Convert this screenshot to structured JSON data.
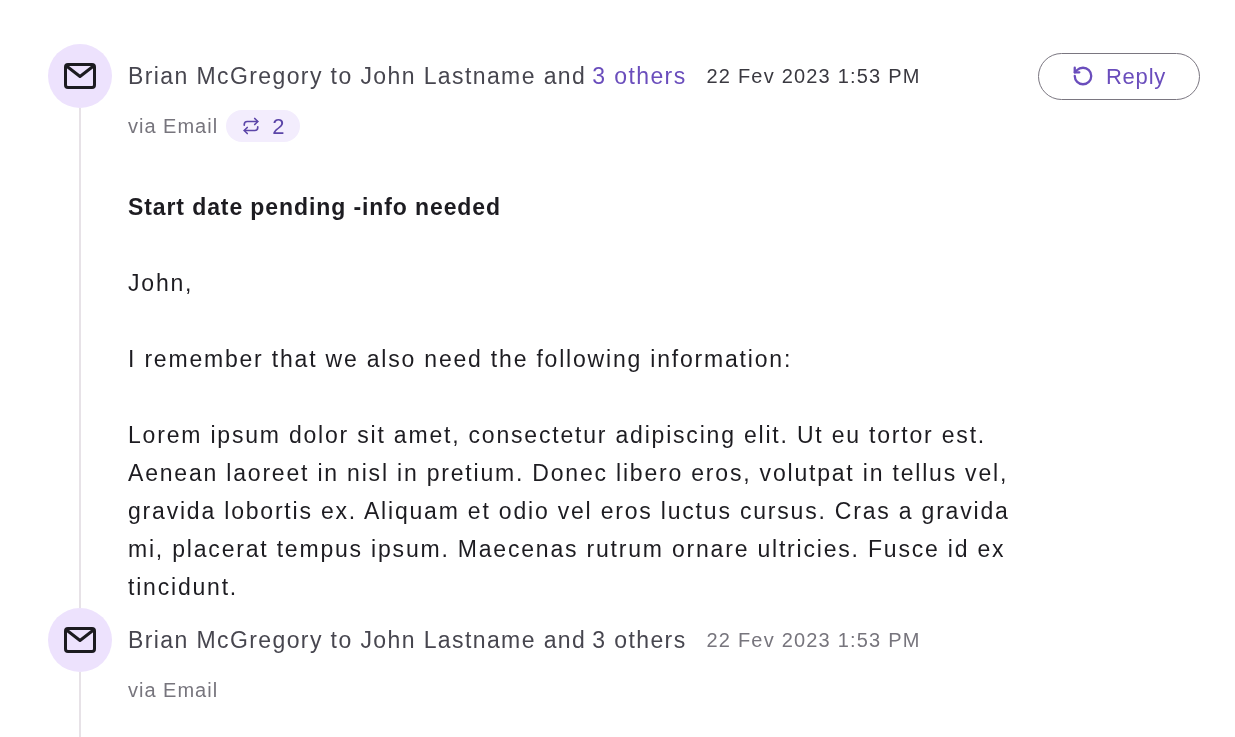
{
  "messages": [
    {
      "expanded": true,
      "header": "Brian McGregory to John Lastname and",
      "others": "3 others",
      "date": "22 Fev 2023 1:53 PM",
      "channel": "via Email",
      "thread_count": "2",
      "reply": "Reply",
      "subject": "Start date pending -info needed",
      "body": [
        "John,",
        "I remember that we also need the following information:",
        "Lorem ipsum dolor sit amet, consectetur adipiscing elit. Ut eu tortor est. Aenean laoreet in nisl in pretium. Donec libero eros, volutpat in tellus vel, gravida lobortis ex. Aliquam et odio vel eros luctus cursus. Cras a gravida mi, placerat tempus ipsum. Maecenas rutrum ornare ultricies. Fusce id ex tincidunt."
      ]
    },
    {
      "expanded": false,
      "header": "Brian McGregory to John Lastname and",
      "others": "3 others",
      "date": "22 Fev 2023 1:53 PM",
      "channel": "via Email"
    }
  ]
}
